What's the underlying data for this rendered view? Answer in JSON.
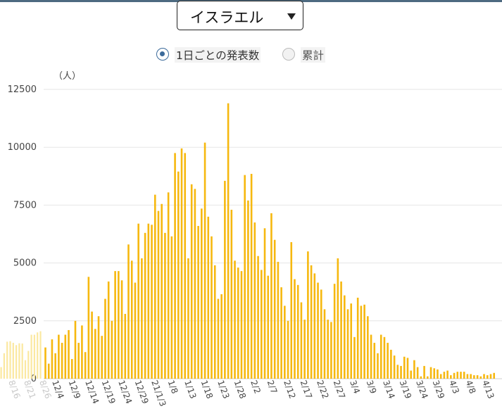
{
  "country_select": {
    "value": "イスラエル",
    "caret_icon": "caret-down-icon"
  },
  "mode_options": [
    {
      "label": "1日ごとの発表数",
      "selected": true
    },
    {
      "label": "累計",
      "selected": false
    }
  ],
  "chart_data": {
    "type": "bar",
    "title": "",
    "xlabel": "",
    "ylabel": "（人）",
    "ylim": [
      0,
      12500
    ],
    "yticks": [
      0,
      2500,
      5000,
      7500,
      10000,
      12500
    ],
    "grid": true,
    "legend": "none",
    "bar_color": "#f6b80f",
    "faded_bar_color": "#fbe8a0",
    "x_tick_labels": [
      "8/16",
      "8/21",
      "8/26",
      "12/4",
      "12/9",
      "12/14",
      "12/19",
      "12/24",
      "12/29",
      "21/1/3",
      "1/8",
      "1/13",
      "1/18",
      "1/23",
      "1/28",
      "2/2",
      "2/7",
      "2/12",
      "2/17",
      "2/22",
      "2/27",
      "3/4",
      "3/9",
      "3/14",
      "3/19",
      "3/24",
      "3/29",
      "4/3",
      "4/8",
      "4/13"
    ],
    "faded_values": [
      500,
      1100,
      1600,
      1620,
      1550,
      1450,
      1530,
      1520,
      800,
      1200,
      1900,
      1900,
      2000,
      2050
    ],
    "values": [
      1350,
      650,
      1700,
      1100,
      1900,
      1550,
      1900,
      2100,
      850,
      2500,
      1550,
      2300,
      1150,
      4400,
      2900,
      2150,
      2700,
      1850,
      3450,
      4200,
      2500,
      4650,
      4650,
      4250,
      2800,
      5800,
      5100,
      4150,
      6700,
      5200,
      6300,
      6700,
      6650,
      7950,
      7250,
      7550,
      6300,
      8050,
      6150,
      9750,
      8950,
      9950,
      9750,
      5200,
      8400,
      8200,
      6600,
      7350,
      10200,
      7000,
      6150,
      4900,
      3450,
      3650,
      8550,
      11900,
      7300,
      5100,
      4800,
      4650,
      8800,
      7700,
      8850,
      6750,
      5300,
      4700,
      6500,
      4450,
      7150,
      6000,
      5050,
      3950,
      3150,
      2500,
      5900,
      4300,
      4050,
      3300,
      2550,
      5500,
      4900,
      4550,
      4150,
      3850,
      3000,
      2550,
      2450,
      4100,
      5200,
      4200,
      3600,
      3000,
      3250,
      1800,
      3500,
      3150,
      3200,
      2700,
      1900,
      1550,
      1100,
      1900,
      1800,
      1550,
      1250,
      1000,
      600,
      550,
      950,
      900,
      350,
      800,
      500,
      100,
      550,
      100,
      500,
      450,
      400,
      200,
      300,
      350,
      150,
      250,
      300,
      300,
      300,
      200,
      200,
      150,
      150,
      100,
      200,
      150,
      200,
      250
    ]
  }
}
